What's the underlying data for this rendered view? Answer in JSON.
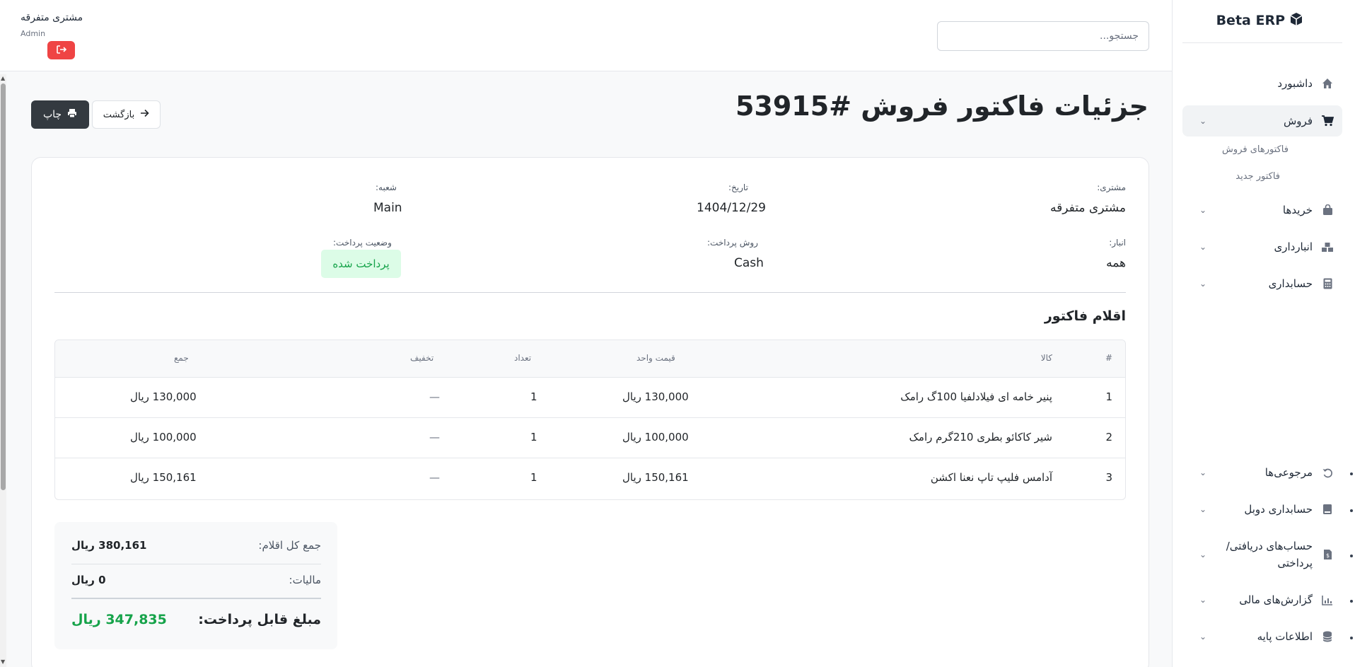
{
  "sidebar": {
    "brand": "Beta ERP",
    "brand_icon": "cube-icon",
    "items": [
      {
        "label": "داشبورد",
        "icon": "home-icon"
      },
      {
        "label": "فروش",
        "icon": "cart-icon",
        "expanded": true
      },
      {
        "label": "خریدها",
        "icon": "bag-icon"
      },
      {
        "label": "انبارداری",
        "icon": "warehouse-icon"
      },
      {
        "label": "حسابداری",
        "icon": "calculator-icon"
      },
      {
        "label": "مرجوعی‌ها",
        "icon": "undo-icon"
      },
      {
        "label": "حسابداری دوبل",
        "icon": "book-icon"
      },
      {
        "label": "حساب‌های دریافتی/پرداختی",
        "label_line1": "حساب‌های دریافتی/",
        "label_line2": "پرداختی",
        "icon": "invoice-icon"
      },
      {
        "label": "گزارش‌های مالی",
        "icon": "chart-icon"
      },
      {
        "label": "اطلاعات پایه",
        "icon": "database-icon"
      }
    ],
    "sales_sub": [
      "فاکتورهای فروش",
      "فاکتور جدید"
    ]
  },
  "header": {
    "search_placeholder": "جستجو...",
    "user_name": "مشتری متفرقه",
    "user_role": "Admin"
  },
  "page": {
    "title": "جزئیات فاکتور فروش #53915",
    "print_label": "چاپ",
    "back_label": "بازگشت"
  },
  "invoice": {
    "customer_label": "مشتری:",
    "customer": "مشتری متفرقه",
    "date_label": "تاریخ:",
    "date": "1404/12/29",
    "branch_label": "شعبه:",
    "branch": "Main",
    "warehouse_label": "انبار:",
    "warehouse": "همه",
    "payment_method_label": "روش پرداخت:",
    "payment_method": "Cash",
    "payment_status_label": "وضعیت پرداخت:",
    "payment_status": "پرداخت شده",
    "payment_status_color": "#16a34a"
  },
  "items_section": {
    "title": "اقلام فاکتور",
    "headers": {
      "index": "#",
      "product": "کالا",
      "unit_price": "قیمت واحد",
      "qty": "تعداد",
      "discount": "تخفیف",
      "total": "جمع"
    },
    "rows": [
      {
        "index": "1",
        "product": "پنیر خامه ای فیلادلفیا 100گ رامک",
        "unit_price": "130,000 ریال",
        "qty": "1",
        "discount": "—",
        "total": "130,000 ریال"
      },
      {
        "index": "2",
        "product": "شیر کاکائو بطری 210گرم رامک",
        "unit_price": "100,000 ریال",
        "qty": "1",
        "discount": "—",
        "total": "100,000 ریال"
      },
      {
        "index": "3",
        "product": "آدامس فلیپ تاپ نعنا اکشن",
        "unit_price": "150,161 ریال",
        "qty": "1",
        "discount": "—",
        "total": "150,161 ریال"
      }
    ]
  },
  "totals": {
    "subtotal_label": "جمع کل اقلام:",
    "subtotal": "380,161 ریال",
    "tax_label": "مالیات:",
    "tax": "0 ریال",
    "grand_label": "مبلغ قابل پرداخت:",
    "grand": "347,835 ریال",
    "grand_color": "#16a34a"
  }
}
